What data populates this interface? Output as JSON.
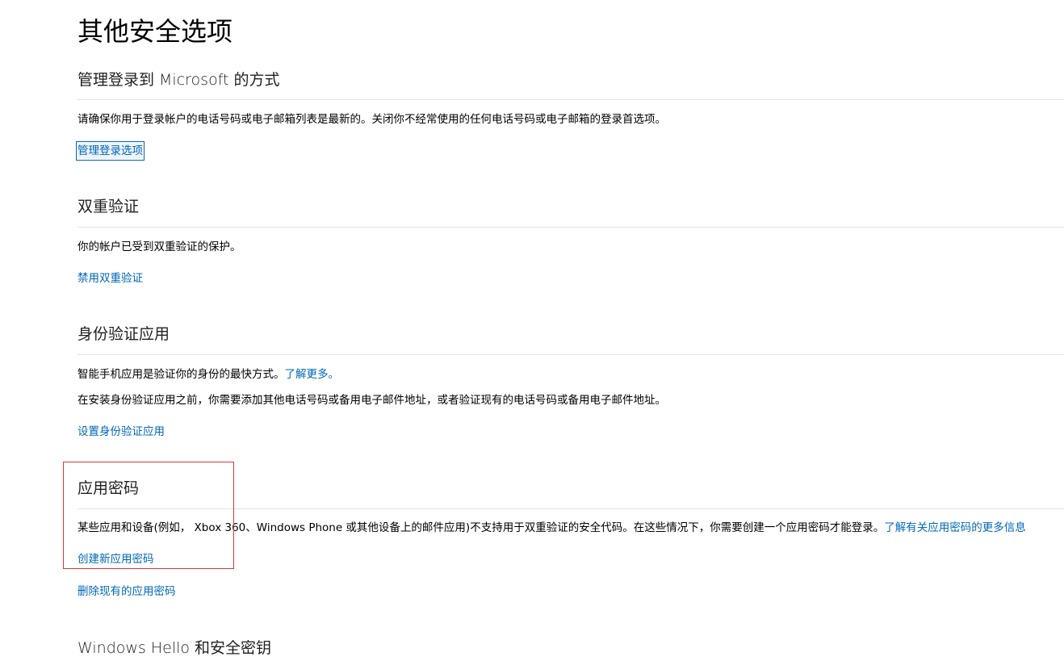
{
  "page": {
    "title": "其他安全选项"
  },
  "sections": {
    "manage_signin": {
      "heading": "管理登录到 Microsoft 的方式",
      "description": "请确保你用于登录帐户的电话号码或电子邮箱列表是最新的。关闭你不经常使用的任何电话号码或电子邮箱的登录首选项。",
      "link": "管理登录选项"
    },
    "two_step": {
      "heading": "双重验证",
      "description": "你的帐户已受到双重验证的保护。",
      "link": "禁用双重验证"
    },
    "authenticator": {
      "heading": "身份验证应用",
      "description_1": "智能手机应用是验证你的身份的最快方式。",
      "learn_more": "了解更多。",
      "description_2": "在安装身份验证应用之前，你需要添加其他电话号码或备用电子邮件地址，或者验证现有的电话号码或备用电子邮件地址。",
      "link": "设置身份验证应用"
    },
    "app_passwords": {
      "heading": "应用密码",
      "description": "某些应用和设备(例如， Xbox 360、Windows Phone 或其他设备上的邮件应用)不支持用于双重验证的安全代码。在这些情况下，你需要创建一个应用密码才能登录。",
      "learn_more": "了解有关应用密码的更多信息",
      "create_link": "创建新应用密码",
      "remove_link": "删除现有的应用密码"
    },
    "windows_hello": {
      "heading": "Windows Hello 和安全密钥"
    }
  },
  "colors": {
    "link": "#0067b8",
    "annotation": "#d9363e",
    "divider": "#e3e3e3"
  }
}
